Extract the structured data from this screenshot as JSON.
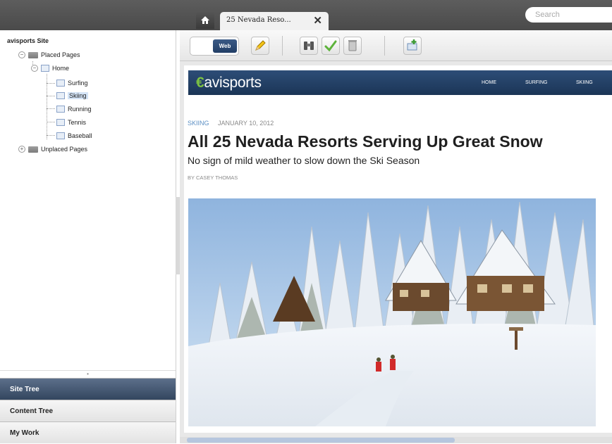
{
  "topbar": {
    "tab_title": "25 Nevada Reso...",
    "search_placeholder": "Search"
  },
  "site_tree": {
    "title": "avisports Site",
    "placed_pages_label": "Placed Pages",
    "home_label": "Home",
    "children": [
      "Surfing",
      "Skiing",
      "Running",
      "Tennis",
      "Baseball"
    ],
    "selected": "Skiing",
    "unplaced_pages_label": "Unplaced Pages"
  },
  "accordion": {
    "site_tree": "Site Tree",
    "content_tree": "Content Tree",
    "my_work": "My Work",
    "active": "Site Tree"
  },
  "toolbar": {
    "toggle_label": "Web"
  },
  "preview": {
    "logo_text": "avisports",
    "nav": [
      "HOME",
      "SURFING",
      "SKIING"
    ],
    "category": "SKIING",
    "date": "JANUARY 10, 2012",
    "headline": "All 25 Nevada Resorts Serving Up Great Snow",
    "subheadline": "No sign of mild weather to slow down the Ski Season",
    "byline": "BY CASEY THOMAS"
  },
  "colors": {
    "topbar": "#4f4f4f",
    "accent_nav": "#1f3a5f",
    "logo_green": "#7cc242",
    "active_tab": "#3a4d67",
    "category_link": "#5b8fc4"
  },
  "icons": [
    "home-icon",
    "close-icon",
    "edit-pencil-icon",
    "preview-binoculars-icon",
    "approve-check-icon",
    "delete-trash-icon",
    "add-page-icon"
  ]
}
